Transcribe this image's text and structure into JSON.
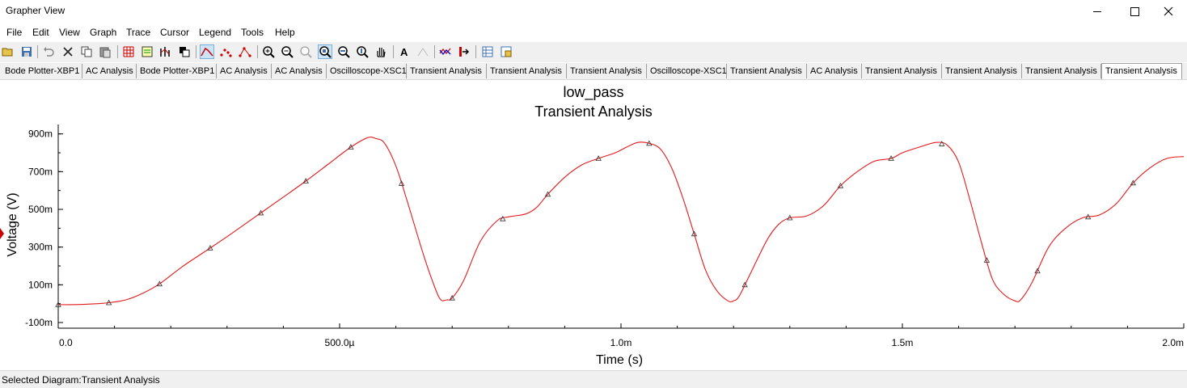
{
  "window": {
    "title": "Grapher View"
  },
  "menu": [
    "File",
    "Edit",
    "View",
    "Graph",
    "Trace",
    "Cursor",
    "Legend",
    "Tools",
    "Help"
  ],
  "tabs": [
    "Bode Plotter-XBP1",
    "AC Analysis",
    "Bode Plotter-XBP1",
    "AC Analysis",
    "AC Analysis",
    "Oscilloscope-XSC1",
    "Transient Analysis",
    "Transient Analysis",
    "Transient Analysis",
    "Oscilloscope-XSC1",
    "Transient Analysis",
    "AC Analysis",
    "Transient Analysis",
    "Transient Analysis",
    "Transient Analysis",
    "Transient Analysis"
  ],
  "active_tab_index": 15,
  "toolbar_icons": [
    "open-icon",
    "save-icon",
    "undo-icon",
    "cut-icon",
    "copy-icon",
    "paste-icon",
    "grid-icon",
    "legend-icon",
    "overlay-traces-icon",
    "reverse-colors-icon",
    "select-curve-icon",
    "select-marks-icon",
    "select-line-marks-icon",
    "zoom-in-icon",
    "zoom-out-icon",
    "zoom-full-icon",
    "zoom-area-icon",
    "zoom-x-icon",
    "zoom-y-icon",
    "pan-icon",
    "text-icon",
    "disabled-icon",
    "add-trace-icon",
    "export-icon",
    "properties-icon",
    "print-icon"
  ],
  "status": {
    "text": "Selected Diagram:Transient Analysis"
  },
  "chart_data": {
    "type": "line",
    "title": "low_pass",
    "subtitle": "Transient Analysis",
    "xlabel": "Time (s)",
    "ylabel": "Voltage (V)",
    "xlim": [
      0,
      0.002
    ],
    "ylim": [
      -0.13,
      0.95
    ],
    "x_ticks": [
      {
        "v": 0,
        "label": "0.0"
      },
      {
        "v": 0.0005,
        "label": "500.0µ"
      },
      {
        "v": 0.001,
        "label": "1.0m"
      },
      {
        "v": 0.0015,
        "label": "1.5m"
      },
      {
        "v": 0.002,
        "label": "2.0m"
      }
    ],
    "y_ticks": [
      {
        "v": 0.9,
        "label": "900m"
      },
      {
        "v": 0.7,
        "label": "700m"
      },
      {
        "v": 0.5,
        "label": "500m"
      },
      {
        "v": 0.3,
        "label": "300m"
      },
      {
        "v": 0.1,
        "label": "100m"
      },
      {
        "v": -0.1,
        "label": "-100m"
      }
    ],
    "color": "#e31a1c",
    "series": [
      {
        "x": [
          0,
          3e-05,
          7e-05,
          9e-05,
          0.00012,
          0.00015,
          0.00018,
          0.00022,
          0.00026,
          0.0003,
          0.00035,
          0.0004,
          0.00044,
          0.00048,
          0.00052,
          0.00055,
          0.000565,
          0.00058,
          0.0006,
          0.00062,
          0.00065,
          0.00067,
          0.00068,
          0.00069,
          0.0007,
          0.00072,
          0.00075,
          0.00078,
          0.0008,
          0.00083,
          0.00085,
          0.00087,
          0.0009,
          0.00093,
          0.00096,
          0.00099,
          0.00101,
          0.00103,
          0.00105,
          0.00107,
          0.00109,
          0.00111,
          0.00113,
          0.00115,
          0.00117,
          0.00119,
          0.0012,
          0.00121,
          0.00123,
          0.00126,
          0.00128,
          0.0013,
          0.00133,
          0.00136,
          0.00139,
          0.00142,
          0.00145,
          0.00148,
          0.0015,
          0.00153,
          0.00156,
          0.00158,
          0.0016,
          0.00162,
          0.00164,
          0.00166,
          0.00168,
          0.0017,
          0.00171,
          0.00173,
          0.00176,
          0.00179,
          0.00182,
          0.00185,
          0.00188,
          0.00191,
          0.00194,
          0.00197,
          0.002
        ],
        "y": [
          -0.005,
          -0.005,
          0,
          0.005,
          0.02,
          0.055,
          0.105,
          0.195,
          0.275,
          0.355,
          0.46,
          0.565,
          0.65,
          0.74,
          0.83,
          0.88,
          0.875,
          0.85,
          0.73,
          0.545,
          0.25,
          0.08,
          0.02,
          0.02,
          0.03,
          0.12,
          0.33,
          0.44,
          0.46,
          0.475,
          0.51,
          0.58,
          0.67,
          0.735,
          0.77,
          0.8,
          0.83,
          0.855,
          0.85,
          0.82,
          0.72,
          0.56,
          0.37,
          0.18,
          0.07,
          0.015,
          0.015,
          0.04,
          0.16,
          0.34,
          0.42,
          0.455,
          0.465,
          0.52,
          0.625,
          0.7,
          0.755,
          0.77,
          0.8,
          0.83,
          0.855,
          0.84,
          0.75,
          0.55,
          0.33,
          0.13,
          0.05,
          0.015,
          0.02,
          0.11,
          0.3,
          0.4,
          0.455,
          0.47,
          0.53,
          0.64,
          0.72,
          0.77,
          0.78
        ],
        "marker_x": [
          0,
          9e-05,
          0.00018,
          0.00027,
          0.00036,
          0.00044,
          0.00052,
          0.00061,
          0.0007,
          0.00079,
          0.00087,
          0.00096,
          0.00105,
          0.00113,
          0.00122,
          0.0013,
          0.00139,
          0.00148,
          0.00157,
          0.00165,
          0.00174,
          0.00183,
          0.00191
        ]
      }
    ]
  }
}
